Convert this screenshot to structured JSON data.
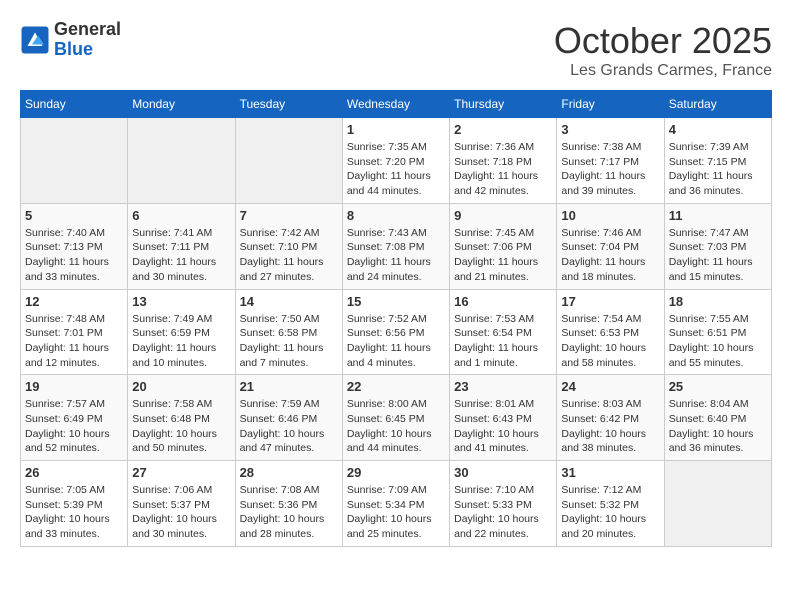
{
  "header": {
    "logo_general": "General",
    "logo_blue": "Blue",
    "title": "October 2025",
    "location": "Les Grands Carmes, France"
  },
  "weekdays": [
    "Sunday",
    "Monday",
    "Tuesday",
    "Wednesday",
    "Thursday",
    "Friday",
    "Saturday"
  ],
  "weeks": [
    [
      {
        "day": "",
        "info": ""
      },
      {
        "day": "",
        "info": ""
      },
      {
        "day": "",
        "info": ""
      },
      {
        "day": "1",
        "info": "Sunrise: 7:35 AM\nSunset: 7:20 PM\nDaylight: 11 hours\nand 44 minutes."
      },
      {
        "day": "2",
        "info": "Sunrise: 7:36 AM\nSunset: 7:18 PM\nDaylight: 11 hours\nand 42 minutes."
      },
      {
        "day": "3",
        "info": "Sunrise: 7:38 AM\nSunset: 7:17 PM\nDaylight: 11 hours\nand 39 minutes."
      },
      {
        "day": "4",
        "info": "Sunrise: 7:39 AM\nSunset: 7:15 PM\nDaylight: 11 hours\nand 36 minutes."
      }
    ],
    [
      {
        "day": "5",
        "info": "Sunrise: 7:40 AM\nSunset: 7:13 PM\nDaylight: 11 hours\nand 33 minutes."
      },
      {
        "day": "6",
        "info": "Sunrise: 7:41 AM\nSunset: 7:11 PM\nDaylight: 11 hours\nand 30 minutes."
      },
      {
        "day": "7",
        "info": "Sunrise: 7:42 AM\nSunset: 7:10 PM\nDaylight: 11 hours\nand 27 minutes."
      },
      {
        "day": "8",
        "info": "Sunrise: 7:43 AM\nSunset: 7:08 PM\nDaylight: 11 hours\nand 24 minutes."
      },
      {
        "day": "9",
        "info": "Sunrise: 7:45 AM\nSunset: 7:06 PM\nDaylight: 11 hours\nand 21 minutes."
      },
      {
        "day": "10",
        "info": "Sunrise: 7:46 AM\nSunset: 7:04 PM\nDaylight: 11 hours\nand 18 minutes."
      },
      {
        "day": "11",
        "info": "Sunrise: 7:47 AM\nSunset: 7:03 PM\nDaylight: 11 hours\nand 15 minutes."
      }
    ],
    [
      {
        "day": "12",
        "info": "Sunrise: 7:48 AM\nSunset: 7:01 PM\nDaylight: 11 hours\nand 12 minutes."
      },
      {
        "day": "13",
        "info": "Sunrise: 7:49 AM\nSunset: 6:59 PM\nDaylight: 11 hours\nand 10 minutes."
      },
      {
        "day": "14",
        "info": "Sunrise: 7:50 AM\nSunset: 6:58 PM\nDaylight: 11 hours\nand 7 minutes."
      },
      {
        "day": "15",
        "info": "Sunrise: 7:52 AM\nSunset: 6:56 PM\nDaylight: 11 hours\nand 4 minutes."
      },
      {
        "day": "16",
        "info": "Sunrise: 7:53 AM\nSunset: 6:54 PM\nDaylight: 11 hours\nand 1 minute."
      },
      {
        "day": "17",
        "info": "Sunrise: 7:54 AM\nSunset: 6:53 PM\nDaylight: 10 hours\nand 58 minutes."
      },
      {
        "day": "18",
        "info": "Sunrise: 7:55 AM\nSunset: 6:51 PM\nDaylight: 10 hours\nand 55 minutes."
      }
    ],
    [
      {
        "day": "19",
        "info": "Sunrise: 7:57 AM\nSunset: 6:49 PM\nDaylight: 10 hours\nand 52 minutes."
      },
      {
        "day": "20",
        "info": "Sunrise: 7:58 AM\nSunset: 6:48 PM\nDaylight: 10 hours\nand 50 minutes."
      },
      {
        "day": "21",
        "info": "Sunrise: 7:59 AM\nSunset: 6:46 PM\nDaylight: 10 hours\nand 47 minutes."
      },
      {
        "day": "22",
        "info": "Sunrise: 8:00 AM\nSunset: 6:45 PM\nDaylight: 10 hours\nand 44 minutes."
      },
      {
        "day": "23",
        "info": "Sunrise: 8:01 AM\nSunset: 6:43 PM\nDaylight: 10 hours\nand 41 minutes."
      },
      {
        "day": "24",
        "info": "Sunrise: 8:03 AM\nSunset: 6:42 PM\nDaylight: 10 hours\nand 38 minutes."
      },
      {
        "day": "25",
        "info": "Sunrise: 8:04 AM\nSunset: 6:40 PM\nDaylight: 10 hours\nand 36 minutes."
      }
    ],
    [
      {
        "day": "26",
        "info": "Sunrise: 7:05 AM\nSunset: 5:39 PM\nDaylight: 10 hours\nand 33 minutes."
      },
      {
        "day": "27",
        "info": "Sunrise: 7:06 AM\nSunset: 5:37 PM\nDaylight: 10 hours\nand 30 minutes."
      },
      {
        "day": "28",
        "info": "Sunrise: 7:08 AM\nSunset: 5:36 PM\nDaylight: 10 hours\nand 28 minutes."
      },
      {
        "day": "29",
        "info": "Sunrise: 7:09 AM\nSunset: 5:34 PM\nDaylight: 10 hours\nand 25 minutes."
      },
      {
        "day": "30",
        "info": "Sunrise: 7:10 AM\nSunset: 5:33 PM\nDaylight: 10 hours\nand 22 minutes."
      },
      {
        "day": "31",
        "info": "Sunrise: 7:12 AM\nSunset: 5:32 PM\nDaylight: 10 hours\nand 20 minutes."
      },
      {
        "day": "",
        "info": ""
      }
    ]
  ]
}
